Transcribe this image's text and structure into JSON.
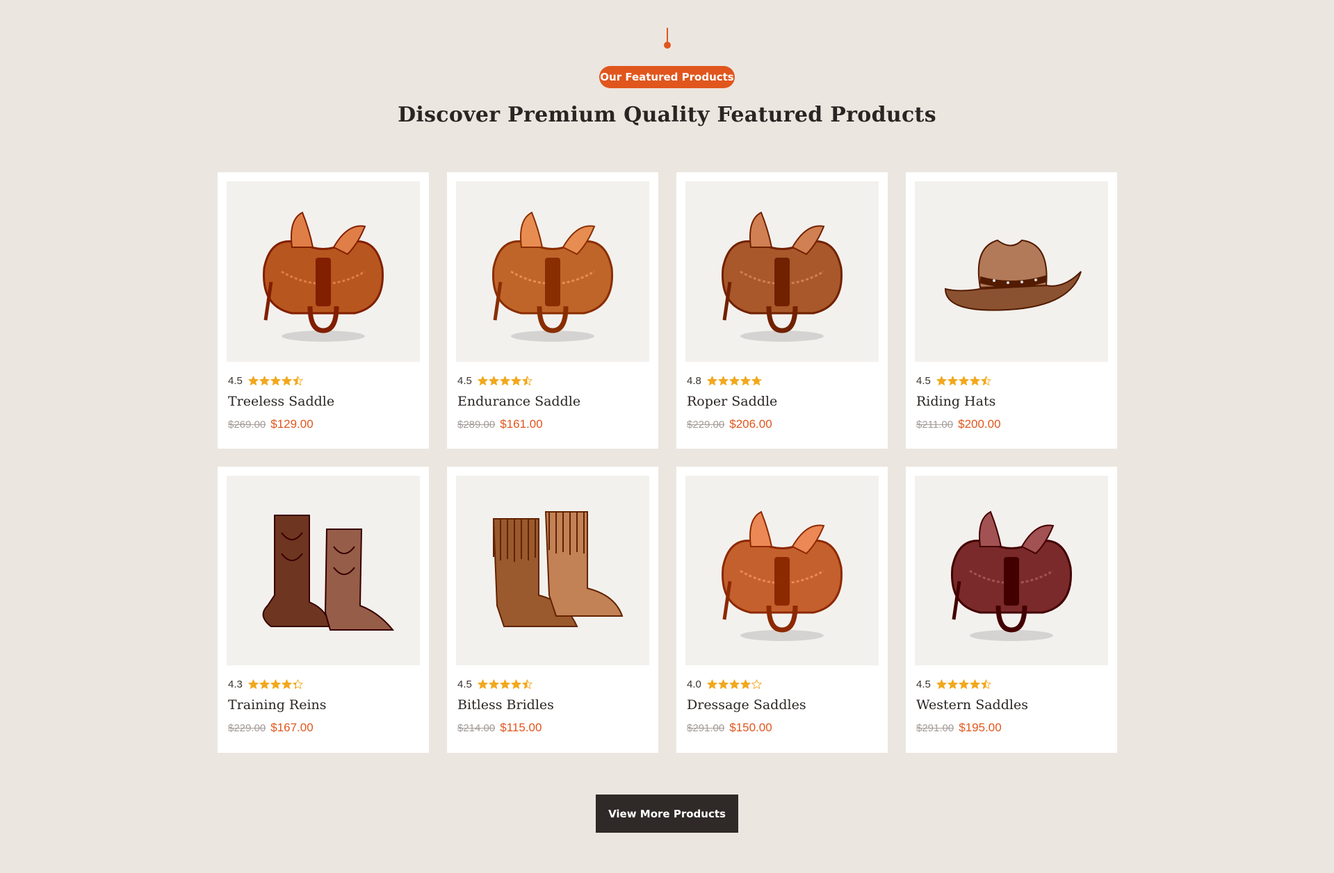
{
  "header": {
    "badge": "Our Featured Products",
    "title": "Discover Premium Quality Featured Products"
  },
  "colors": {
    "accent": "#e0561d",
    "star": "#f2a81d",
    "background": "#ebe6e0",
    "button": "#2f2927"
  },
  "products": [
    {
      "rating": "4.5",
      "rating_value": 4.5,
      "name": "Treeless Saddle",
      "old_price": "$269.00",
      "price": "$129.00",
      "icon": "saddle-icon",
      "tone": "#b8561f"
    },
    {
      "rating": "4.5",
      "rating_value": 4.5,
      "name": "Endurance Saddle",
      "old_price": "$289.00",
      "price": "$161.00",
      "icon": "saddle-icon",
      "tone": "#c0652a"
    },
    {
      "rating": "4.8",
      "rating_value": 4.8,
      "name": "Roper Saddle",
      "old_price": "$229.00",
      "price": "$206.00",
      "icon": "saddle-icon",
      "tone": "#a8582a"
    },
    {
      "rating": "4.5",
      "rating_value": 4.5,
      "name": "Riding Hats",
      "old_price": "$211.00",
      "price": "$200.00",
      "icon": "cowboy-hat-icon",
      "tone": "#8a5230"
    },
    {
      "rating": "4.3",
      "rating_value": 4.3,
      "name": "Training Reins",
      "old_price": "$229.00",
      "price": "$167.00",
      "icon": "cowboy-boots-icon",
      "tone": "#6e3520"
    },
    {
      "rating": "4.5",
      "rating_value": 4.5,
      "name": "Bitless Bridles",
      "old_price": "$214.00",
      "price": "$115.00",
      "icon": "fringe-boots-icon",
      "tone": "#9a5a2e"
    },
    {
      "rating": "4.0",
      "rating_value": 4.0,
      "name": "Dressage Saddles",
      "old_price": "$291.00",
      "price": "$150.00",
      "icon": "saddle-icon",
      "tone": "#c4602d"
    },
    {
      "rating": "4.5",
      "rating_value": 4.5,
      "name": "Western Saddles",
      "old_price": "$291.00",
      "price": "$195.00",
      "icon": "saddle-icon",
      "tone": "#7a2a2a"
    }
  ],
  "cta": {
    "label": "View More Products"
  }
}
